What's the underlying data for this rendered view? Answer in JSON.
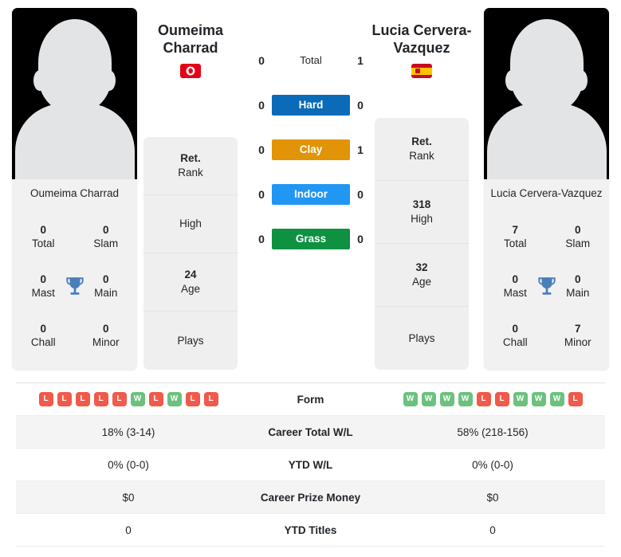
{
  "players": {
    "left": {
      "name": "Oumeima Charrad",
      "name_display": "Oumeima Charrad",
      "flag": "tunisia-flag",
      "rank_value": "Ret.",
      "rank_label": "Rank",
      "high_value": "",
      "high_label": "High",
      "age_value": "24",
      "age_label": "Age",
      "plays_value": "",
      "plays_label": "Plays",
      "titles": {
        "total_value": "0",
        "total_label": "Total",
        "slam_value": "0",
        "slam_label": "Slam",
        "mast_value": "0",
        "mast_label": "Mast",
        "main_value": "0",
        "main_label": "Main",
        "chall_value": "0",
        "chall_label": "Chall",
        "minor_value": "0",
        "minor_label": "Minor"
      },
      "form": [
        "L",
        "L",
        "L",
        "L",
        "L",
        "W",
        "L",
        "W",
        "L",
        "L"
      ],
      "career_total_wl": "18% (3-14)",
      "ytd_wl": "0% (0-0)",
      "career_prize_money": "$0",
      "ytd_titles": "0"
    },
    "right": {
      "name": "Lucia Cervera-Vazquez",
      "name_display": "Lucia Cervera-Vazquez",
      "flag": "spain-flag",
      "rank_value": "Ret.",
      "rank_label": "Rank",
      "high_value": "318",
      "high_label": "High",
      "age_value": "32",
      "age_label": "Age",
      "plays_value": "",
      "plays_label": "Plays",
      "titles": {
        "total_value": "7",
        "total_label": "Total",
        "slam_value": "0",
        "slam_label": "Slam",
        "mast_value": "0",
        "mast_label": "Mast",
        "main_value": "0",
        "main_label": "Main",
        "chall_value": "0",
        "chall_label": "Chall",
        "minor_value": "7",
        "minor_label": "Minor"
      },
      "form": [
        "W",
        "W",
        "W",
        "W",
        "L",
        "L",
        "W",
        "W",
        "W",
        "L"
      ],
      "career_total_wl": "58% (218-156)",
      "ytd_wl": "0% (0-0)",
      "career_prize_money": "$0",
      "ytd_titles": "0"
    }
  },
  "surfaces": [
    {
      "label": "Total",
      "left_score": "0",
      "right_score": "1",
      "color": "none",
      "style": "plain"
    },
    {
      "label": "Hard",
      "left_score": "0",
      "right_score": "0",
      "color": "#0b6bb8",
      "style": "pill"
    },
    {
      "label": "Clay",
      "left_score": "0",
      "right_score": "1",
      "color": "#e09406",
      "style": "pill"
    },
    {
      "label": "Indoor",
      "left_score": "0",
      "right_score": "0",
      "color": "#2196f3",
      "style": "pill"
    },
    {
      "label": "Grass",
      "left_score": "0",
      "right_score": "0",
      "color": "#0e9141",
      "style": "pill"
    }
  ],
  "stats_rows": [
    {
      "label": "Form",
      "key": "form",
      "type": "badges"
    },
    {
      "label": "Career Total W/L",
      "key": "career_total_wl",
      "type": "text"
    },
    {
      "label": "YTD W/L",
      "key": "ytd_wl",
      "type": "text"
    },
    {
      "label": "Career Prize Money",
      "key": "career_prize_money",
      "type": "text"
    },
    {
      "label": "YTD Titles",
      "key": "ytd_titles",
      "type": "text"
    }
  ],
  "colors": {
    "win_badge": "#6cc17e",
    "loss_badge": "#f1594a",
    "trophy": "#4a7ebb",
    "card_bg": "#efefef",
    "alt_row": "#f4f4f4"
  },
  "icons": {
    "trophy": "trophy-icon"
  }
}
